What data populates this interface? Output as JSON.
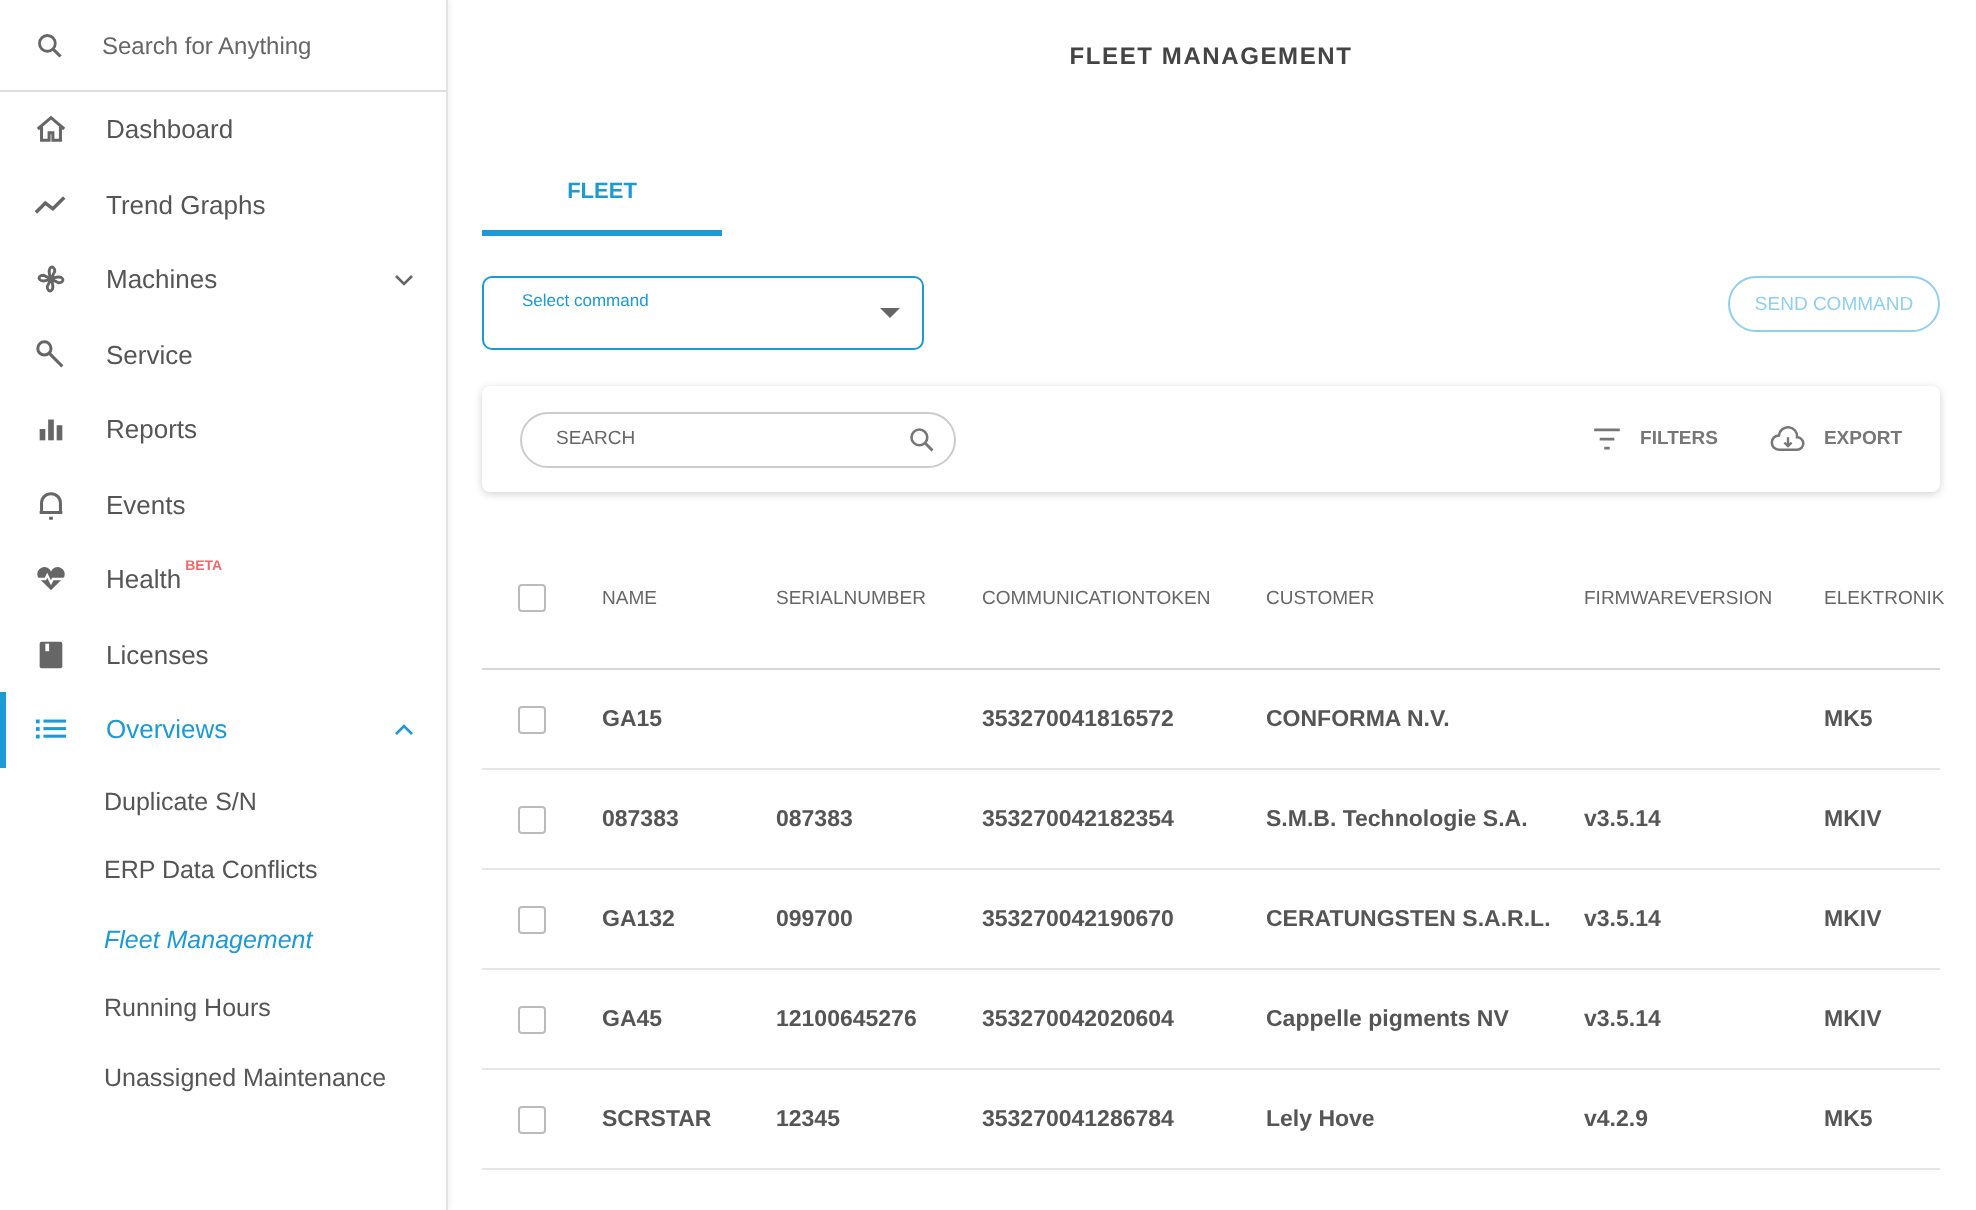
{
  "sidebar": {
    "search": {
      "placeholder": "Search for Anything"
    },
    "items": [
      {
        "label": "Dashboard",
        "selected": false
      },
      {
        "label": "Trend Graphs",
        "selected": false
      },
      {
        "label": "Machines",
        "selected": false,
        "expanded": false
      },
      {
        "label": "Service",
        "selected": false
      },
      {
        "label": "Reports",
        "selected": false
      },
      {
        "label": "Events",
        "selected": false
      },
      {
        "label": "Health",
        "selected": false,
        "badge": "BETA"
      },
      {
        "label": "Licenses",
        "selected": false
      },
      {
        "label": "Overviews",
        "selected": true,
        "expanded": true,
        "children": [
          {
            "label": "Duplicate S/N",
            "selected": false
          },
          {
            "label": "ERP Data Conflicts",
            "selected": false
          },
          {
            "label": "Fleet Management",
            "selected": true
          },
          {
            "label": "Running Hours",
            "selected": false
          },
          {
            "label": "Unassigned Maintenance",
            "selected": false
          }
        ]
      }
    ]
  },
  "page_title": "FLEET MANAGEMENT",
  "tabs": [
    {
      "label": "FLEET",
      "selected": true
    }
  ],
  "command_select": {
    "label": "Select command"
  },
  "send_button": {
    "label": "SEND COMMAND",
    "disabled": true
  },
  "toolbar": {
    "search": {
      "placeholder": "SEARCH"
    },
    "filters": "FILTERS",
    "export": "EXPORT"
  },
  "table": {
    "columns": [
      "NAME",
      "SERIALNUMBER",
      "COMMUNICATIONTOKEN",
      "CUSTOMER",
      "FIRMWAREVERSION",
      "ELEKTRONIK"
    ],
    "header_checked": false,
    "rows": [
      {
        "checked": false,
        "cells": [
          "GA15",
          "",
          "353270041816572",
          "CONFORMA N.V.",
          "",
          "MK5"
        ]
      },
      {
        "checked": false,
        "cells": [
          "087383",
          "087383",
          "353270042182354",
          "S.M.B. Technologie S.A.",
          "v3.5.14",
          "MKIV"
        ]
      },
      {
        "checked": false,
        "cells": [
          "GA132",
          "099700",
          "353270042190670",
          "CERATUNGSTEN S.A.R.L.",
          "v3.5.14",
          "MKIV"
        ]
      },
      {
        "checked": false,
        "cells": [
          "GA45",
          "12100645276",
          "353270042020604",
          "Cappelle pigments NV",
          "v3.5.14",
          "MKIV"
        ]
      },
      {
        "checked": false,
        "cells": [
          "SCRSTAR",
          "12345",
          "353270041286784",
          "Lely Hove",
          "v4.2.9",
          "MK5"
        ]
      }
    ]
  }
}
